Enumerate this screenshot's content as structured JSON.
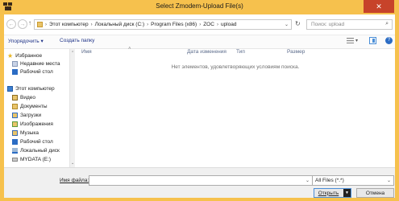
{
  "window": {
    "title": "Select Zmodem-Upload File(s)"
  },
  "address": {
    "crumbs": [
      "Этот компьютер",
      "Локальный диск (C:)",
      "Program Files (x86)",
      "ZOC",
      "upload"
    ]
  },
  "search": {
    "placeholder": "Поиск: upload"
  },
  "toolbar": {
    "organize_label": "Упорядочить ▾",
    "new_folder_label": "Создать папку"
  },
  "sidebar": {
    "favorites_label": "Избранное",
    "favorites": [
      {
        "label": "Недавние места",
        "icon": "recent-places-icon"
      },
      {
        "label": "Рабочий стол",
        "icon": "desktop-icon"
      }
    ],
    "computer_label": "Этот компьютер",
    "computer_items": [
      {
        "label": "Видео",
        "icon": "video-folder-icon"
      },
      {
        "label": "Документы",
        "icon": "documents-folder-icon"
      },
      {
        "label": "Загрузки",
        "icon": "downloads-folder-icon"
      },
      {
        "label": "Изображения",
        "icon": "pictures-folder-icon"
      },
      {
        "label": "Музыка",
        "icon": "music-folder-icon"
      },
      {
        "label": "Рабочий стол",
        "icon": "desktop-folder-icon"
      },
      {
        "label": "Локальный диск",
        "icon": "local-disk-icon"
      },
      {
        "label": "MYDATA (E:)",
        "icon": "drive-icon"
      }
    ]
  },
  "columns": {
    "name": "Имя",
    "date": "Дата изменения",
    "type": "Тип",
    "size": "Размер"
  },
  "content": {
    "empty_message": "Нет элементов, удовлетворяющих условиям поиска."
  },
  "footer": {
    "filename_label": "Имя файла:",
    "filename_value": "",
    "filter_value": "All Files (*.*)",
    "open_label": "Открыть",
    "cancel_label": "Отмена"
  },
  "colors": {
    "frame": "#f6c14d",
    "close": "#c7432a",
    "link": "#1e3287"
  }
}
